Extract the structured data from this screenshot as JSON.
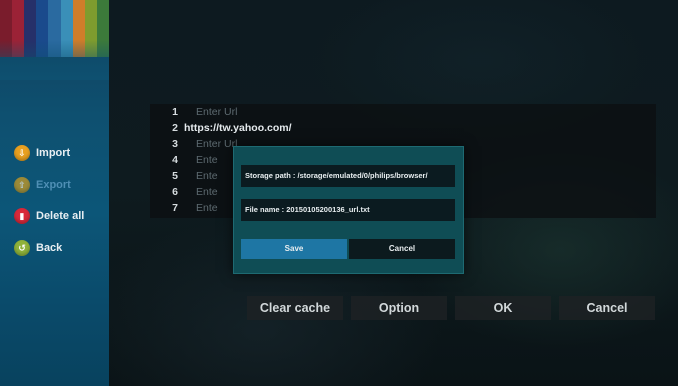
{
  "colors": {
    "sidebar_top": "#113f5c",
    "sidebar_bottom": "#08425e",
    "dialog_bg": "#0f4d55",
    "save_button": "#1e76a4",
    "stripes": [
      "#7a1c2c",
      "#9b2236",
      "#26306a",
      "#1a4a8c",
      "#2a6aa0",
      "#3a8fb8",
      "#cf7d2a",
      "#7e9c2e",
      "#3c7a3a"
    ]
  },
  "sidebar": {
    "items": [
      {
        "label": "Import",
        "icon": "import-icon",
        "color": "#e8a020",
        "glyph": "⇩",
        "enabled": true
      },
      {
        "label": "Export",
        "icon": "export-icon",
        "color": "#d9a21e",
        "glyph": "⇧",
        "enabled": false
      },
      {
        "label": "Delete all",
        "icon": "trash-icon",
        "color": "#d8293a",
        "glyph": "▮",
        "enabled": true
      },
      {
        "label": "Back",
        "icon": "back-icon",
        "color": "#8fb23a",
        "glyph": "↺",
        "enabled": true
      }
    ]
  },
  "url_list": {
    "rows": [
      {
        "num": "1",
        "text": "Enter Url",
        "filled": false
      },
      {
        "num": "2",
        "text": "https://tw.yahoo.com/",
        "filled": true
      },
      {
        "num": "3",
        "text": "Enter Url",
        "filled": false
      },
      {
        "num": "4",
        "text": "Ente",
        "filled": false
      },
      {
        "num": "5",
        "text": "Ente",
        "filled": false
      },
      {
        "num": "6",
        "text": "Ente",
        "filled": false
      },
      {
        "num": "7",
        "text": "Ente",
        "filled": false
      }
    ]
  },
  "dialog": {
    "storage_path": "Storage path : /storage/emulated/0/philips/browser/",
    "file_name": "File name : 20150105200136_url.txt",
    "save_label": "Save",
    "cancel_label": "Cancel"
  },
  "bottom_buttons": {
    "clear_cache": "Clear cache",
    "option": "Option",
    "ok": "OK",
    "cancel": "Cancel"
  }
}
